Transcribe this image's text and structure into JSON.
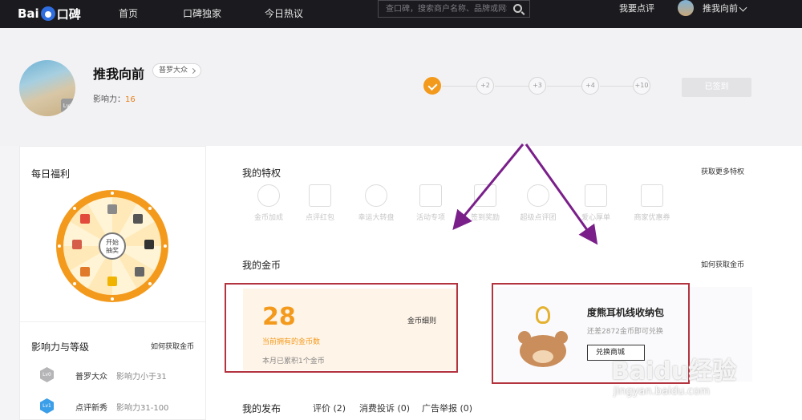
{
  "nav": {
    "logo_text": "Bai",
    "logo_suffix": "口碑",
    "links": [
      "首页",
      "口碑独家",
      "今日热议"
    ],
    "search_placeholder": "查口碑，搜索商户名称、品牌或网址",
    "review_link": "我要点评",
    "username": "推我向前"
  },
  "profile": {
    "name": "推我向前",
    "level_badge": "普罗大众",
    "avatar_level": "Lv0",
    "influence_label": "影响力：",
    "influence_value": "16",
    "checkin_steps": [
      "+2",
      "+3",
      "+4",
      "+10"
    ],
    "checkin_button": "已签到"
  },
  "sidebar": {
    "daily_title": "每日福利",
    "wheel_center": [
      "开始",
      "抽奖"
    ],
    "level_title": "影响力与等级",
    "level_link": "如何获取金币",
    "levels": [
      {
        "badge": "Lv0",
        "name": "普罗大众",
        "desc": "影响力小于31",
        "color": "#b5b5b8"
      },
      {
        "badge": "Lv1",
        "name": "点评新秀",
        "desc": "影响力31-100",
        "color": "#3a9ee8"
      }
    ]
  },
  "main": {
    "priv_title": "我的特权",
    "priv_link": "获取更多特权",
    "privileges": [
      "金币加成",
      "点评红包",
      "幸运大转盘",
      "活动专项",
      "签到奖励",
      "超级点评团",
      "爱心厚单",
      "商家优惠券"
    ],
    "coins_title": "我的金币",
    "coins_link": "如何获取金币",
    "coins": {
      "count": "28",
      "label": "当前拥有的金币数",
      "detail": "金币细则",
      "month": "本月已累积1个金币"
    },
    "shop": {
      "title": "度熊耳机线收纳包",
      "sub": "还差2872金币即可兑换",
      "button": "兑换商城"
    },
    "pub_title": "我的发布",
    "pub_items": [
      "评价 (2)",
      "消费投诉 (0)",
      "广告举报 (0)"
    ]
  },
  "watermark": {
    "text": "Baidu经验",
    "url": "jingyan.baidu.com"
  },
  "colors": {
    "accent": "#f39a1d",
    "annotation": "#b3333f",
    "arrow": "#7a1f8a"
  }
}
